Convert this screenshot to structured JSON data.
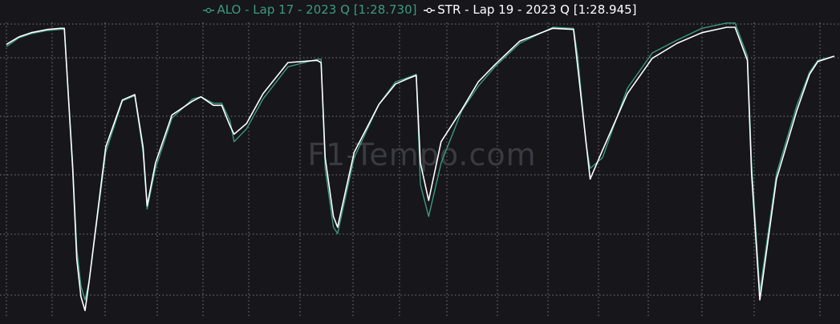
{
  "watermark": "F1-Tempo.com",
  "chart_data": {
    "type": "line",
    "title": "",
    "xlabel": "",
    "ylabel": "",
    "grid": true,
    "legend_position": "top-center",
    "xlim": [
      0,
      100
    ],
    "ylim": [
      60,
      330
    ],
    "x": [
      0,
      1.5,
      3,
      5,
      6.5,
      7,
      8,
      8.5,
      9,
      9.5,
      10,
      12,
      14,
      15.5,
      16.5,
      17,
      18,
      20,
      22.5,
      23.5,
      25,
      26,
      27,
      27.5,
      29,
      31,
      34,
      37.5,
      38,
      38.5,
      39.5,
      40,
      42,
      45,
      47,
      48.5,
      49.5,
      50,
      51,
      52.5,
      55,
      57,
      59,
      62,
      66,
      68.5,
      69,
      70,
      70.5,
      72,
      75,
      78,
      81,
      84,
      87,
      88,
      89.5,
      90,
      91,
      93,
      95.5,
      97,
      98,
      100
    ],
    "series": [
      {
        "name": "ALO - Lap 17 - 2023 Q [1:28.730]",
        "color": "#3d9a80",
        "values": [
          309,
          317,
          321,
          324,
          325,
          325,
          200,
          120,
          85,
          72,
          90,
          210,
          258,
          263,
          210,
          157,
          195,
          242,
          260,
          262,
          256,
          256,
          240,
          220,
          232,
          260,
          290,
          297,
          297,
          195,
          140,
          134,
          205,
          255,
          276,
          280,
          283,
          180,
          150,
          200,
          249,
          272,
          290,
          312,
          327,
          326,
          300,
          218,
          195,
          205,
          270,
          303,
          315,
          326,
          331,
          331,
          300,
          200,
          80,
          190,
          255,
          285,
          296,
          300
        ]
      },
      {
        "name": "STR - Lap 19 - 2023 Q [1:28.945]",
        "color": "#ffffff",
        "values": [
          311,
          318,
          322,
          325,
          326,
          326,
          195,
          110,
          75,
          62,
          90,
          215,
          259,
          264,
          215,
          160,
          200,
          245,
          258,
          262,
          254,
          254,
          235,
          227,
          237,
          265,
          294,
          296,
          294,
          205,
          150,
          140,
          210,
          255,
          274,
          279,
          282,
          200,
          165,
          220,
          250,
          276,
          292,
          314,
          326,
          325,
          290,
          220,
          185,
          212,
          265,
          298,
          312,
          322,
          327,
          327,
          296,
          190,
          72,
          185,
          250,
          283,
          295,
          300
        ]
      }
    ]
  }
}
